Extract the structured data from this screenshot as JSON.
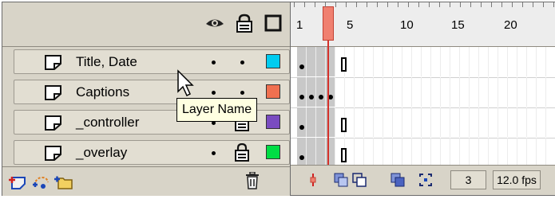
{
  "header": {
    "icons": [
      "eye-icon",
      "lock-icon",
      "outline-icon"
    ]
  },
  "layers": [
    {
      "name": "Title, Date",
      "icon": "layer-icon",
      "visible_dot": true,
      "lock_dot": true,
      "locked": false,
      "color": "#00ccf0"
    },
    {
      "name": "Captions",
      "icon": "layer-icon",
      "visible_dot": true,
      "lock_dot": true,
      "locked": false,
      "color": "#f07050"
    },
    {
      "name": "_controller",
      "icon": "layer-icon",
      "visible_dot": true,
      "lock_dot": false,
      "locked": true,
      "color": "#7a4cc0"
    },
    {
      "name": "_overlay",
      "icon": "layer-icon",
      "visible_dot": true,
      "lock_dot": false,
      "locked": true,
      "color": "#00dd44"
    }
  ],
  "tooltip": {
    "text": "Layer Name"
  },
  "ruler": {
    "labels": [
      "1",
      "5",
      "10",
      "15",
      "20"
    ]
  },
  "timeline_footer": {
    "current_frame": "3",
    "fps": "12.0 fps"
  },
  "layer_footer": {
    "icons": [
      "insert-layer-icon",
      "add-motion-guide-icon",
      "insert-layer-folder-icon",
      "trash-icon"
    ]
  }
}
